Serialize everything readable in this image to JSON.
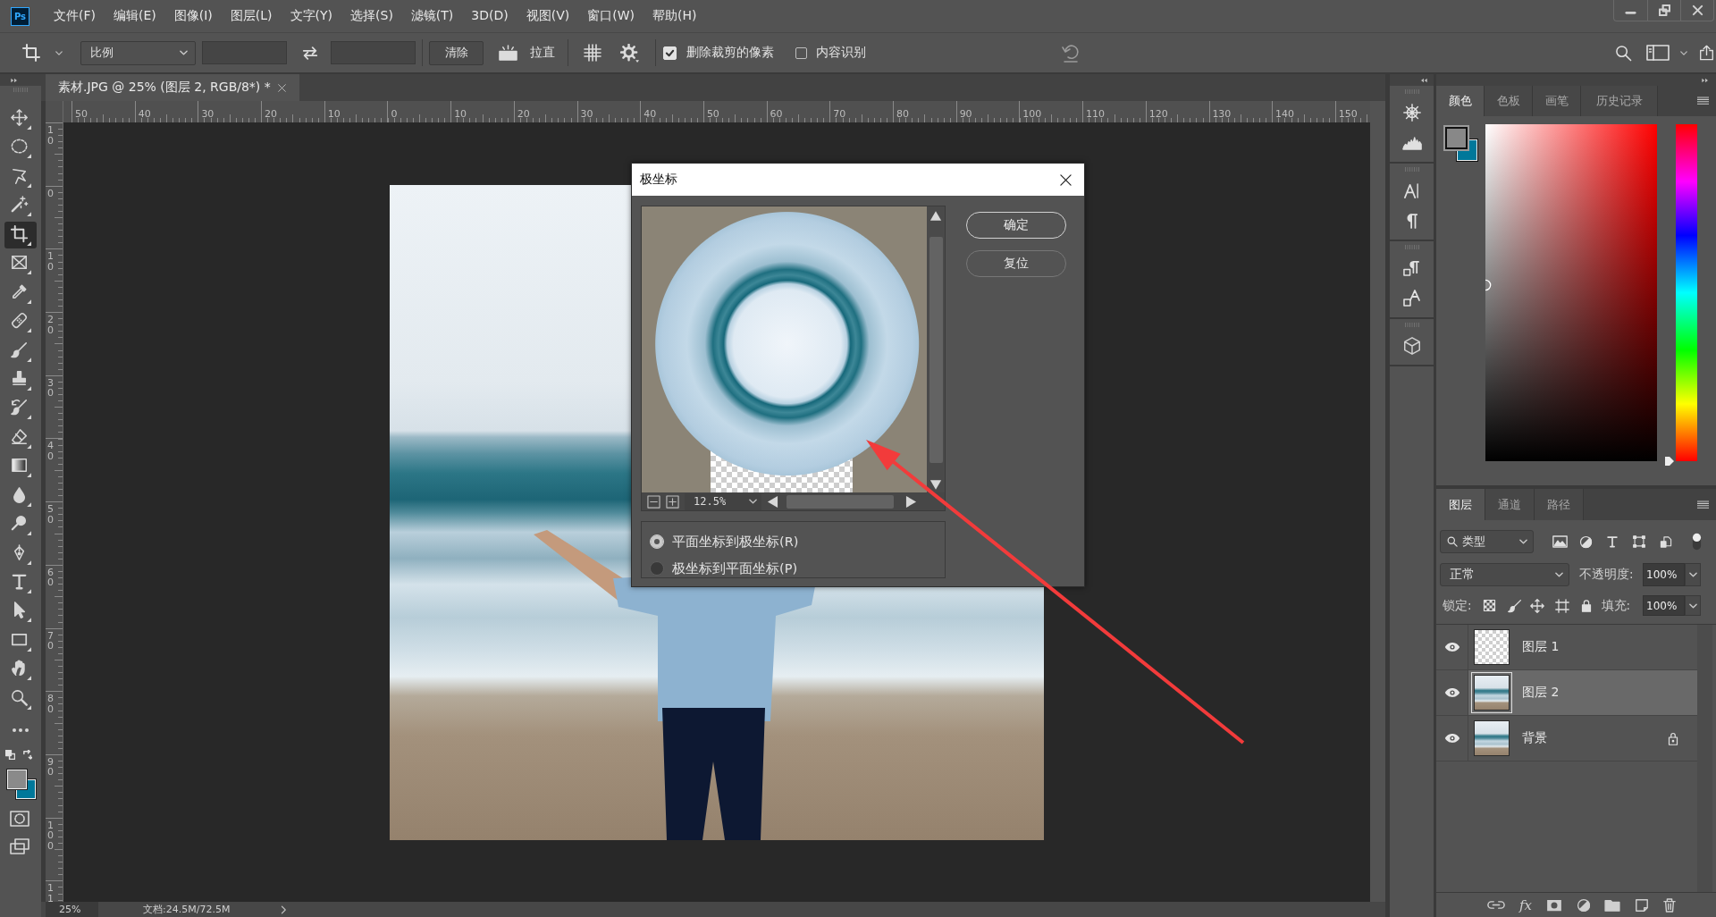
{
  "app_logo": "Ps",
  "menu": [
    "文件(F)",
    "编辑(E)",
    "图像(I)",
    "图层(L)",
    "文字(Y)",
    "选择(S)",
    "滤镜(T)",
    "3D(D)",
    "视图(V)",
    "窗口(W)",
    "帮助(H)"
  ],
  "options_bar": {
    "ratio_dropdown": "比例",
    "clear_button": "清除",
    "straighten_button": "拉直",
    "checkboxes": [
      {
        "label": "删除裁剪的像素",
        "checked": true
      },
      {
        "label": "内容识别",
        "checked": false
      }
    ]
  },
  "tools": [
    {
      "kind": "move",
      "selected": false
    },
    {
      "kind": "marquee",
      "selected": false
    },
    {
      "kind": "lasso",
      "selected": false
    },
    {
      "kind": "wand",
      "selected": false
    },
    {
      "kind": "crop",
      "selected": true
    },
    {
      "kind": "frame",
      "selected": false
    },
    {
      "kind": "eyedropper",
      "selected": false
    },
    {
      "kind": "healing",
      "selected": false
    },
    {
      "kind": "brush",
      "selected": false
    },
    {
      "kind": "stamp",
      "selected": false
    },
    {
      "kind": "history",
      "selected": false
    },
    {
      "kind": "eraser",
      "selected": false
    },
    {
      "kind": "gradient",
      "selected": false
    },
    {
      "kind": "blur",
      "selected": false
    },
    {
      "kind": "dodge",
      "selected": false
    },
    {
      "kind": "pen",
      "selected": false
    },
    {
      "kind": "type",
      "selected": false
    },
    {
      "kind": "path",
      "selected": false
    },
    {
      "kind": "rectangle",
      "selected": false
    },
    {
      "kind": "hand",
      "selected": false
    },
    {
      "kind": "zoom",
      "selected": false
    },
    {
      "kind": "more",
      "selected": false
    }
  ],
  "document_tab": {
    "title": "素材.JPG @ 25% (图层 2, RGB/8*) *",
    "selected": true
  },
  "rulers": {
    "horizontal": [
      "50",
      "40",
      "30",
      "20",
      "10",
      "0",
      "10",
      "20",
      "30",
      "40",
      "50",
      "60",
      "70",
      "80",
      "90",
      "100",
      "110",
      "120",
      "130",
      "140",
      "150"
    ],
    "vertical": [
      "10",
      "0",
      "10",
      "20",
      "30",
      "40",
      "50",
      "60",
      "70",
      "80",
      "90",
      "100",
      "11"
    ]
  },
  "status_bar": {
    "zoom": "25%",
    "document_size": "文档:24.5M/72.5M"
  },
  "dialog": {
    "title": "极坐标",
    "zoom": "12.5%",
    "options": [
      {
        "label": "平面坐标到极坐标(R)",
        "selected": true
      },
      {
        "label": "极坐标到平面坐标(P)",
        "selected": false
      }
    ],
    "buttons": [
      {
        "label": "确定",
        "default": true
      },
      {
        "label": "复位",
        "default": false
      }
    ]
  },
  "color_panel": {
    "tabs": [
      {
        "label": "颜色",
        "selected": true
      },
      {
        "label": "色板",
        "selected": false
      },
      {
        "label": "画笔",
        "selected": false
      },
      {
        "label": "历史记录",
        "selected": false
      }
    ],
    "hue_slider": {
      "level": 0
    }
  },
  "layers_panel": {
    "tabs": [
      {
        "label": "图层",
        "selected": true
      },
      {
        "label": "通道",
        "selected": false
      },
      {
        "label": "路径",
        "selected": false
      }
    ],
    "filter": "类型",
    "blend_mode": "正常",
    "opacity": {
      "label": "不透明度:",
      "value": "100%"
    },
    "lock_label": "锁定:",
    "fill": {
      "label": "填充:",
      "value": "100%"
    },
    "layers": [
      {
        "name": "图层 1",
        "kind": "transparent",
        "visible": true,
        "selected": false,
        "locked": false
      },
      {
        "name": "图层 2",
        "kind": "photo",
        "visible": true,
        "selected": true,
        "locked": false
      },
      {
        "name": "背景",
        "kind": "photo",
        "visible": true,
        "selected": false,
        "locked": true
      }
    ],
    "fx_button": "fx"
  }
}
